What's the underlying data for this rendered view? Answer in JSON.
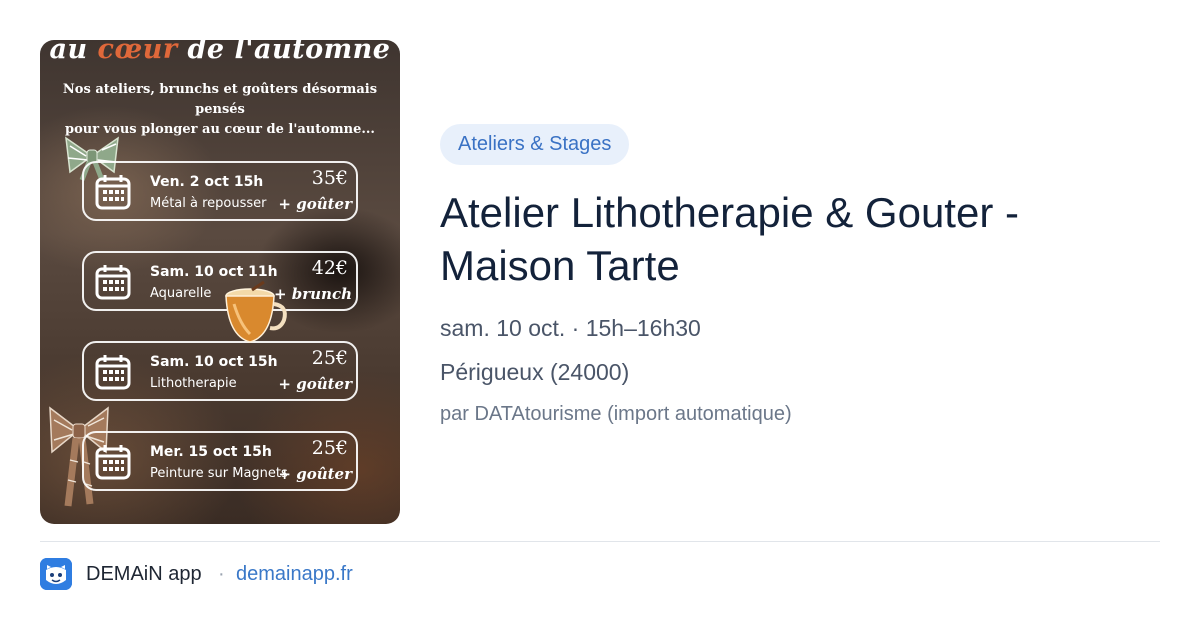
{
  "poster": {
    "title_start": "au ",
    "title_accent": "cœur",
    "title_end": " de l'automne",
    "intro_line1": "Nos ateliers, brunchs et goûters désormais pensés",
    "intro_line2": "pour vous plonger au cœur de l'automne...",
    "events": [
      {
        "date": "Ven. 2 oct 15h",
        "activity": "Métal à repousser",
        "price": "35€",
        "extra": "+ goûter"
      },
      {
        "date": "Sam. 10 oct 11h",
        "activity": "Aquarelle",
        "price": "42€",
        "extra": "+ brunch"
      },
      {
        "date": "Sam. 10 oct 15h",
        "activity": "Lithotherapie",
        "price": "25€",
        "extra": "+ goûter"
      },
      {
        "date": "Mer. 15 oct 15h",
        "activity": "Peinture sur Magnets",
        "price": "25€",
        "extra": "+ goûter"
      }
    ]
  },
  "category": "Ateliers & Stages",
  "title": "Atelier Lithotherapie & Gouter - Maison Tarte",
  "when": "sam. 10 oct. · 15h–16h30",
  "where": "Périgueux (24000)",
  "by": "par DATAtourisme (import automatique)",
  "footer": {
    "app_name": "DEMAiN app",
    "separator": "·",
    "domain": "demainapp.fr"
  },
  "colors": {
    "pill_bg": "#e8f0fb",
    "pill_text": "#3a72c4",
    "title_text": "#13223a",
    "link": "#3a78c8",
    "logo_bg": "#2f7de1",
    "poster_accent": "#e0683a"
  },
  "icons": [
    "calendar-icon",
    "bow-decoration",
    "tea-cup-decoration",
    "app-logo-icon"
  ]
}
